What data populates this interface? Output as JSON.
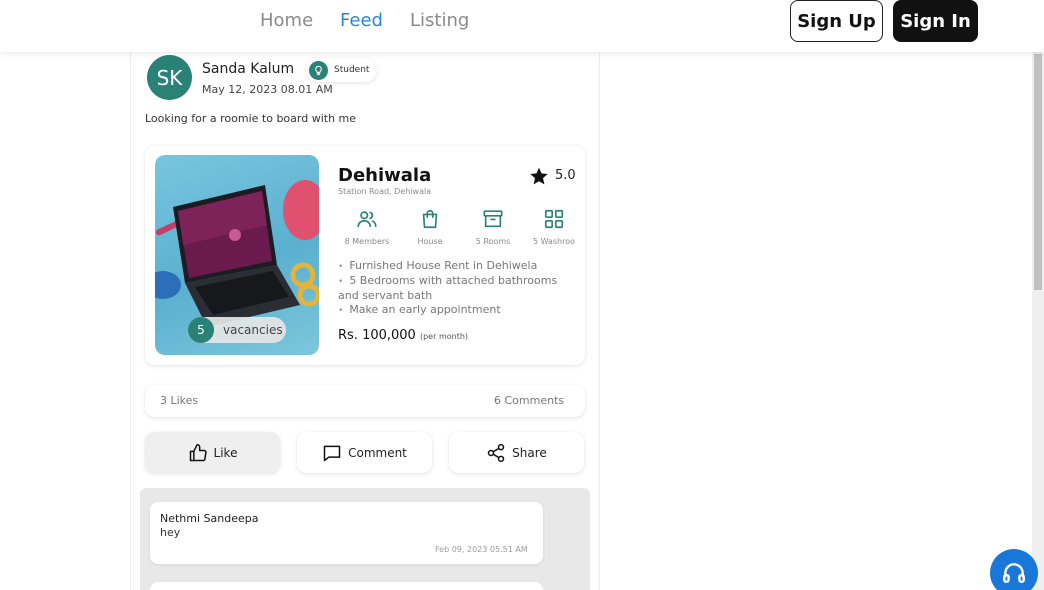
{
  "nav": {
    "links": [
      {
        "label": "Home",
        "active": false
      },
      {
        "label": "Feed",
        "active": true
      },
      {
        "label": "Listing",
        "active": false
      }
    ],
    "sign_up": "Sign Up",
    "sign_in": "Sign In"
  },
  "post": {
    "avatar_initials": "SK",
    "author": "Sanda Kalum",
    "role": "Student",
    "date": "May 12, 2023 08.01 AM",
    "text": "Looking for a roomie to board with me"
  },
  "listing": {
    "title": "Dehiwala",
    "rating": "5.0",
    "address": "Station Road, Dehiwala",
    "vacancies": "5",
    "vacancies_label": "vacancies",
    "features": [
      {
        "label": "8 Members",
        "icon": "users-icon"
      },
      {
        "label": "House",
        "icon": "shopping-bag-icon"
      },
      {
        "label": "5 Rooms",
        "icon": "archive-box-icon"
      },
      {
        "label": "5 Washroo",
        "icon": "grid-icon"
      }
    ],
    "description": [
      "Furnished House Rent in Dehiwela",
      "5 Bedrooms with attached bathrooms and servant bath",
      "Make an early appointment"
    ],
    "price": "Rs. 100,000",
    "price_period": "(per month)"
  },
  "stats": {
    "likes": "3 Likes",
    "comments": "6 Comments"
  },
  "actions": {
    "like": "Like",
    "comment": "Comment",
    "share": "Share"
  },
  "comments": [
    {
      "author": "Nethmi Sandeepa",
      "text": "hey",
      "date": "Feb 09, 2023 05.51 AM"
    }
  ],
  "colors": {
    "accent": "#2b86d6",
    "teal": "#2a8277",
    "fab": "#1877d8"
  }
}
